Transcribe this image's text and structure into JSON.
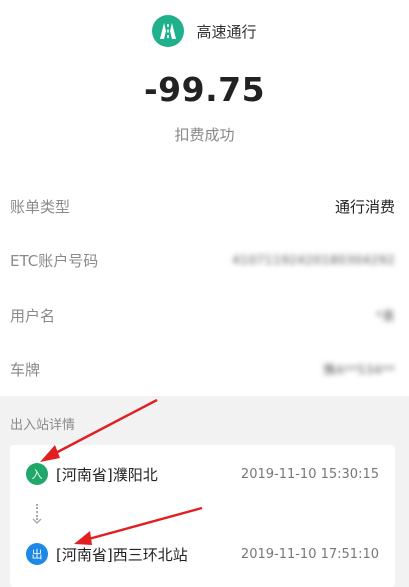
{
  "header": {
    "app_icon": "highway-icon",
    "app_name": "高速通行"
  },
  "amount": "-99.75",
  "status": "扣费成功",
  "details": [
    {
      "label": "账单类型",
      "value": "通行消费",
      "blurred": false
    },
    {
      "label": "ETC账户号码",
      "value": "41071192420180304292",
      "blurred": true
    },
    {
      "label": "用户名",
      "value": "*喜",
      "blurred": true
    },
    {
      "label": "车牌",
      "value": "豫A**534**",
      "blurred": true
    }
  ],
  "stations": {
    "section_title": "出入站详情",
    "entry": {
      "badge": "入",
      "name": "[河南省]濮阳北",
      "time": "2019-11-10 15:30:15"
    },
    "exit": {
      "badge": "出",
      "name": "[河南省]西三环北站",
      "time": "2019-11-10 17:51:10"
    }
  },
  "colors": {
    "brand": "#1fb08c",
    "entry_badge": "#1fa86a",
    "exit_badge": "#1e88e5",
    "annotation_arrow": "#e02020"
  }
}
